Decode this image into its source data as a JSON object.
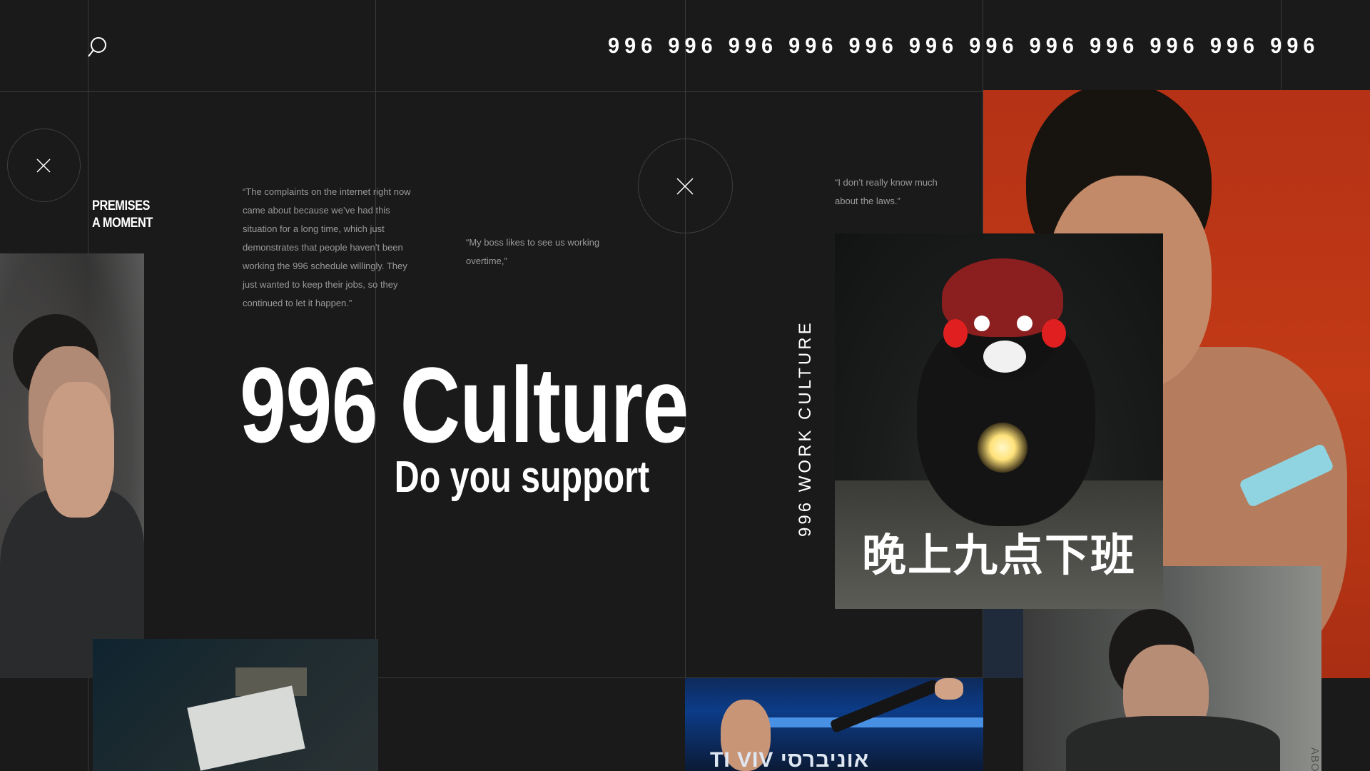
{
  "header": {
    "search_icon": "search-icon",
    "ticker": "996 996 996 996 996 996 996 996 996 996 996 996"
  },
  "sidebar": {
    "label_line1": "PREMISES",
    "label_line2": "A MOMENT"
  },
  "quotes": {
    "q1": "“The complaints on the internet right now came about because we’ve had this situation for a long time, which just demonstrates that people haven’t been working the 996 schedule willingly. They just wanted to keep their jobs, so they continued to let it happen.”",
    "q2": "“My boss likes to see us working overtime,”",
    "q3": "“I don’t really know much about the laws.”"
  },
  "hero": {
    "title": "996 Culture",
    "subtitle": "Do you support"
  },
  "vertical_label": "996 WORK CULTURE",
  "kumamon_caption": "晚上九点下班",
  "bottom_center_text": "TI VIV  אוניברסי",
  "about_tab": "ABOUT",
  "colors": {
    "background": "#1a1a1a",
    "grid_line": "#3a3a3a",
    "quote_text": "#9a9a9a",
    "accent_red": "#c23a16"
  }
}
